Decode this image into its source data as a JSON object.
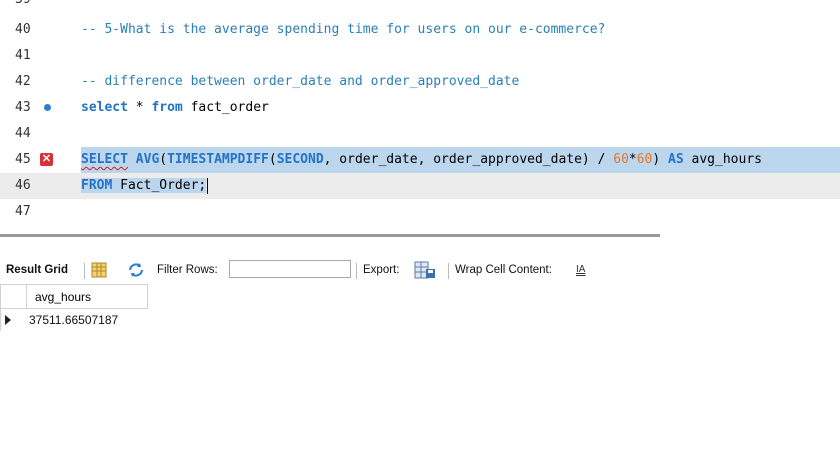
{
  "editor": {
    "lines": [
      {
        "num": "39",
        "text": ""
      },
      {
        "num": "40",
        "text": "-- 5-What is the average spending time for users on our e-commerce?"
      },
      {
        "num": "41",
        "text": ""
      },
      {
        "num": "42",
        "text": "-- difference between order_date and order_approved_date"
      },
      {
        "num": "43",
        "kw1": "select",
        "mid1": " * ",
        "kw2": "from",
        "rest": " fact_order"
      },
      {
        "num": "44",
        "text": ""
      },
      {
        "num": "45",
        "select": "SELECT",
        "avg": "AVG",
        "ts": "TIMESTAMPDIFF",
        "second": "SECOND",
        "args": ", order_date, order_approved_date) / ",
        "n1": "60",
        "star": "*",
        "n2": "60",
        "close": ") ",
        "as": "AS",
        "alias": " avg_hours"
      },
      {
        "num": "46",
        "from": "FROM",
        "table": " Fact_Order;"
      },
      {
        "num": "47",
        "text": ""
      }
    ]
  },
  "toolbar": {
    "result_grid": "Result Grid",
    "filter_rows": "Filter Rows:",
    "filter_value": "",
    "export": "Export:",
    "wrap": "Wrap Cell Content:",
    "wrap_icon": "IA"
  },
  "grid": {
    "columns": [
      "avg_hours"
    ],
    "rows": [
      [
        "37511.66507187"
      ]
    ]
  }
}
